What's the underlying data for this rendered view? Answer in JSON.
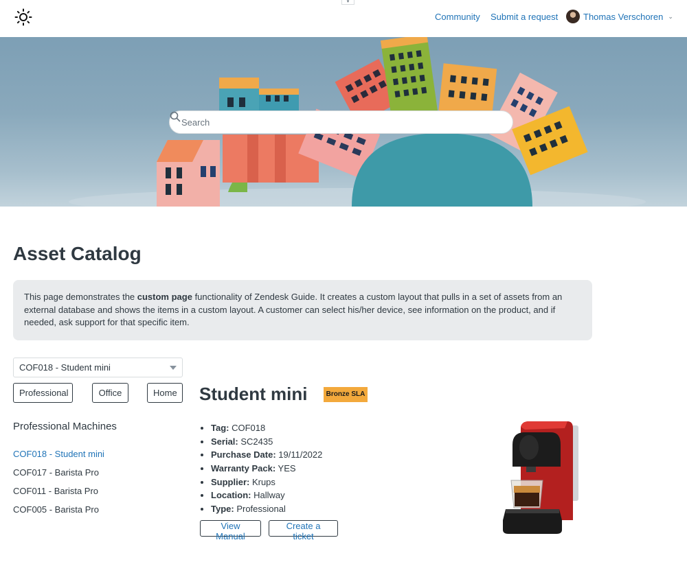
{
  "header": {
    "logo_icon": "sun-icon",
    "nav": {
      "community": "Community",
      "submit_request": "Submit a request",
      "user_name": "Thomas Verschoren"
    },
    "top_tab_glyph": "▾",
    "user_menu_glyph": "⌄"
  },
  "hero": {
    "search_placeholder": "Search"
  },
  "page": {
    "title": "Asset Catalog",
    "intro": {
      "prefix": "This page demonstrates the ",
      "bold": "custom page",
      "suffix": " functionality of Zendesk Guide. It creates a custom layout that pulls in a set of assets from an external database and shows the items in a custom layout. A customer can select his/her device, see information on the product, and if needed, ask support for that specific item."
    }
  },
  "sidebar": {
    "selected_asset": "COF018 - Student mini",
    "filters": [
      "Professional",
      "Office",
      "Home"
    ],
    "section_heading": "Professional Machines",
    "machines": [
      {
        "label": "COF018 - Student mini",
        "active": true
      },
      {
        "label": "COF017 - Barista Pro",
        "active": false
      },
      {
        "label": "COF011 - Barista Pro",
        "active": false
      },
      {
        "label": "COF005 - Barista Pro",
        "active": false
      }
    ]
  },
  "product": {
    "name": "Student mini",
    "sla_badge": "Bronze SLA",
    "specs": [
      {
        "label": "Tag:",
        "value": " COF018"
      },
      {
        "label": "Serial:",
        "value": " SC2435"
      },
      {
        "label": "Purchase Date:",
        "value": " 19/11/2022"
      },
      {
        "label": "Warranty Pack:",
        "value": " YES"
      },
      {
        "label": "Supplier:",
        "value": " Krups"
      },
      {
        "label": "Location:",
        "value": " Hallway"
      },
      {
        "label": "Type:",
        "value": " Professional"
      }
    ],
    "actions": {
      "view_manual": "View Manual",
      "create_ticket": "Create a ticket"
    }
  },
  "colors": {
    "link": "#1f73b7",
    "text": "#2f3941",
    "sla_badge": "#f3a93c",
    "intro_bg": "#e9ebed"
  }
}
